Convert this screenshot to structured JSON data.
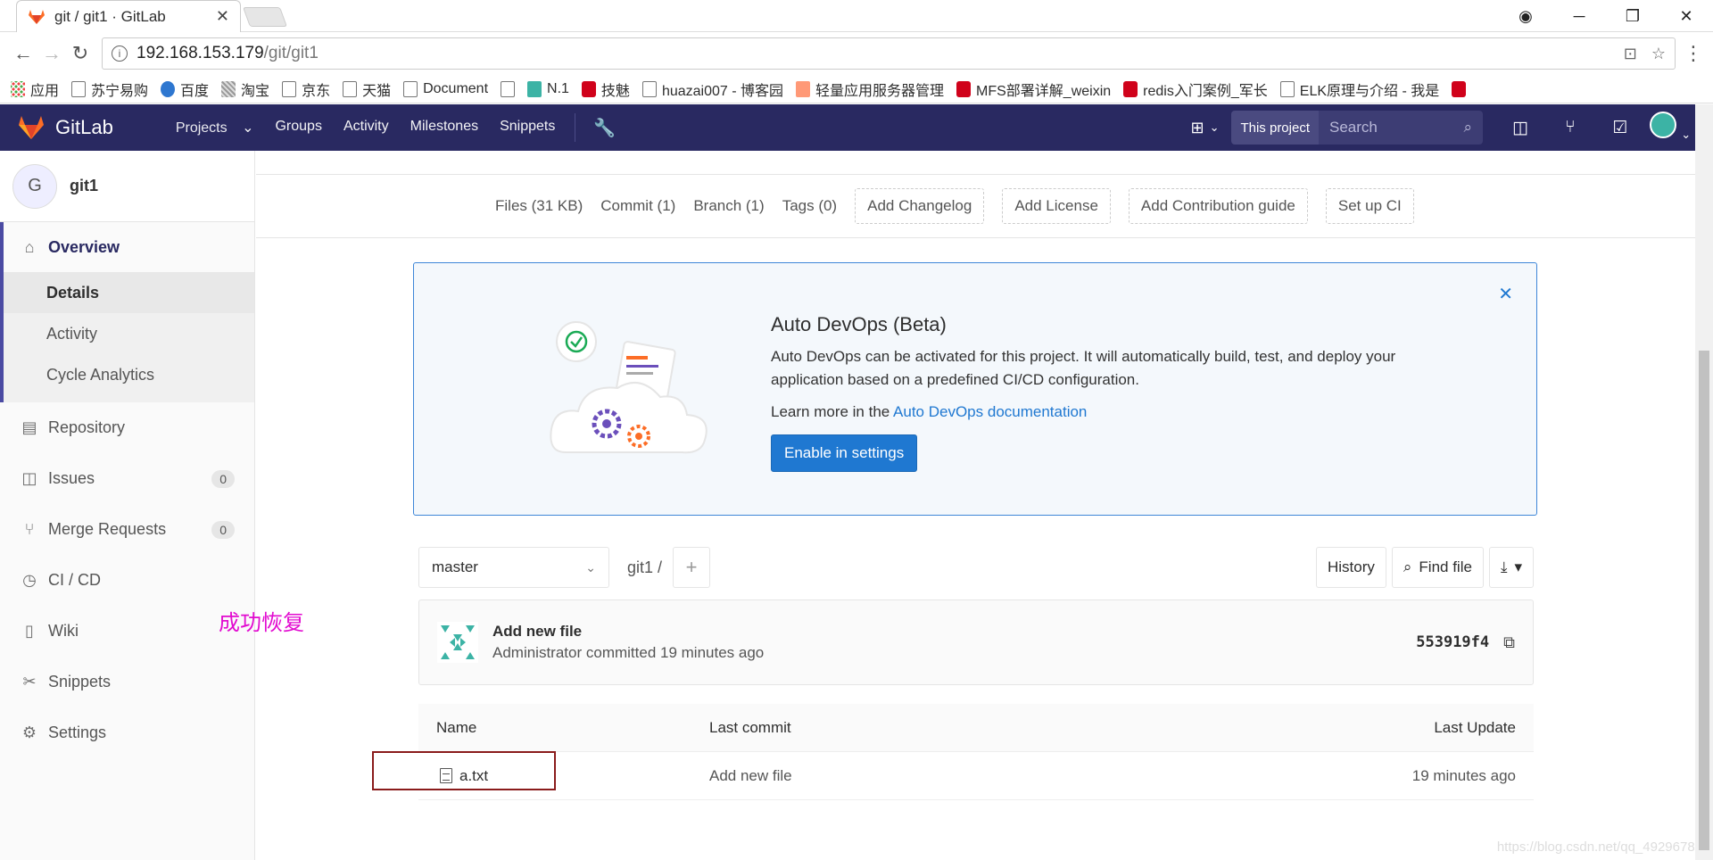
{
  "browser": {
    "tab_title": "git / git1 · GitLab",
    "url_host": "192.168.153.179",
    "url_path": "/git/git1",
    "bookmarks": [
      "应用",
      "苏宁易购",
      "百度",
      "淘宝",
      "京东",
      "天猫",
      "Document",
      "",
      "N.1",
      "技魅",
      "huazai007 - 博客园",
      "轻量应用服务器管理",
      "MFS部署详解_weixin",
      "redis入门案例_军长",
      "ELK原理与介绍 - 我是",
      ""
    ]
  },
  "nav": {
    "brand": "GitLab",
    "links": [
      "Projects",
      "Groups",
      "Activity",
      "Milestones",
      "Snippets"
    ],
    "search_scope": "This project",
    "search_placeholder": "Search"
  },
  "sidebar": {
    "avatar_letter": "G",
    "project_name": "git1",
    "overview": "Overview",
    "sub": [
      "Details",
      "Activity",
      "Cycle Analytics"
    ],
    "items": [
      {
        "label": "Repository"
      },
      {
        "label": "Issues",
        "count": "0"
      },
      {
        "label": "Merge Requests",
        "count": "0"
      },
      {
        "label": "CI / CD"
      },
      {
        "label": "Wiki"
      },
      {
        "label": "Snippets"
      },
      {
        "label": "Settings"
      }
    ]
  },
  "stats": {
    "files": "Files (31 KB)",
    "commit": "Commit (1)",
    "branch": "Branch (1)",
    "tags": "Tags (0)",
    "add_changelog": "Add Changelog",
    "add_license": "Add License",
    "add_contribution": "Add Contribution guide",
    "setup_ci": "Set up CI"
  },
  "devops": {
    "title": "Auto DevOps (Beta)",
    "text": "Auto DevOps can be activated for this project. It will automatically build, test, and deploy your application based on a predefined CI/CD configuration.",
    "learn_prefix": "Learn more in the ",
    "learn_link": "Auto DevOps documentation",
    "button": "Enable in settings"
  },
  "tree": {
    "branch": "master",
    "crumb": "git1",
    "crumb_sep": "/",
    "history": "History",
    "find_file": "Find file"
  },
  "commit": {
    "message": "Add new file",
    "meta": "Administrator committed 19 minutes ago",
    "sha": "553919f4"
  },
  "files": {
    "headers": [
      "Name",
      "Last commit",
      "Last Update"
    ],
    "rows": [
      {
        "name": "a.txt",
        "commit": "Add new file",
        "updated": "19 minutes ago"
      }
    ]
  },
  "annotation": "成功恢复",
  "watermark": "https://blog.csdn.net/qq_49296785",
  "colors": {
    "nav": "#292961",
    "primary": "#1f78d1",
    "annotation": "#e20bd0",
    "redbox": "#8a1b1b"
  }
}
